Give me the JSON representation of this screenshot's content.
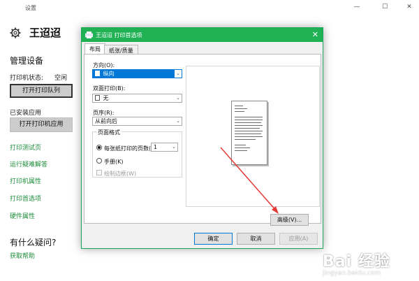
{
  "settings": {
    "window_title": "设置",
    "header_title": "王迢迢",
    "win_controls": {
      "minimize": "—",
      "maximize": "☐",
      "close": "✕"
    },
    "manage_heading": "管理设备",
    "printer_status_label": "打印机状态:",
    "printer_status_value": "空闲",
    "open_queue_button": "打开打印队列",
    "installed_apps_label": "已安装应用",
    "open_printer_app_button": "打开打印机应用",
    "links": [
      "打印测试页",
      "运行疑难解答",
      "打印机属性",
      "打印首选项",
      "硬件属性"
    ],
    "questions_heading": "有什么疑问?",
    "help_link": "获取帮助"
  },
  "dialog": {
    "title": "王迢迢 打印首选项",
    "close": "✕",
    "tabs": [
      "布局",
      "纸张/质量"
    ],
    "orientation_label": "方向(O):",
    "orientation_value": "纵向",
    "duplex_label": "双面打印(B):",
    "duplex_value": "无",
    "page_order_label": "页序(R):",
    "page_order_value": "从前向后",
    "page_format_group": "页面格式",
    "pages_per_sheet_label": "每张纸打印的页数(S",
    "pages_per_sheet_value": "1",
    "booklet_label": "手册(K)",
    "draw_borders_label": "绘制边框(W)",
    "advanced_button": "高级(V)...",
    "ok_button": "确定",
    "cancel_button": "取消",
    "apply_button": "应用(A)"
  },
  "watermark": {
    "logo_text": "Bai 经验",
    "url": "jingyan.baidu.com"
  },
  "colors": {
    "accent_green": "#1fb154",
    "link_green": "#1e8c3b",
    "selection_blue": "#0078d7",
    "arrow_red": "#e53935"
  }
}
